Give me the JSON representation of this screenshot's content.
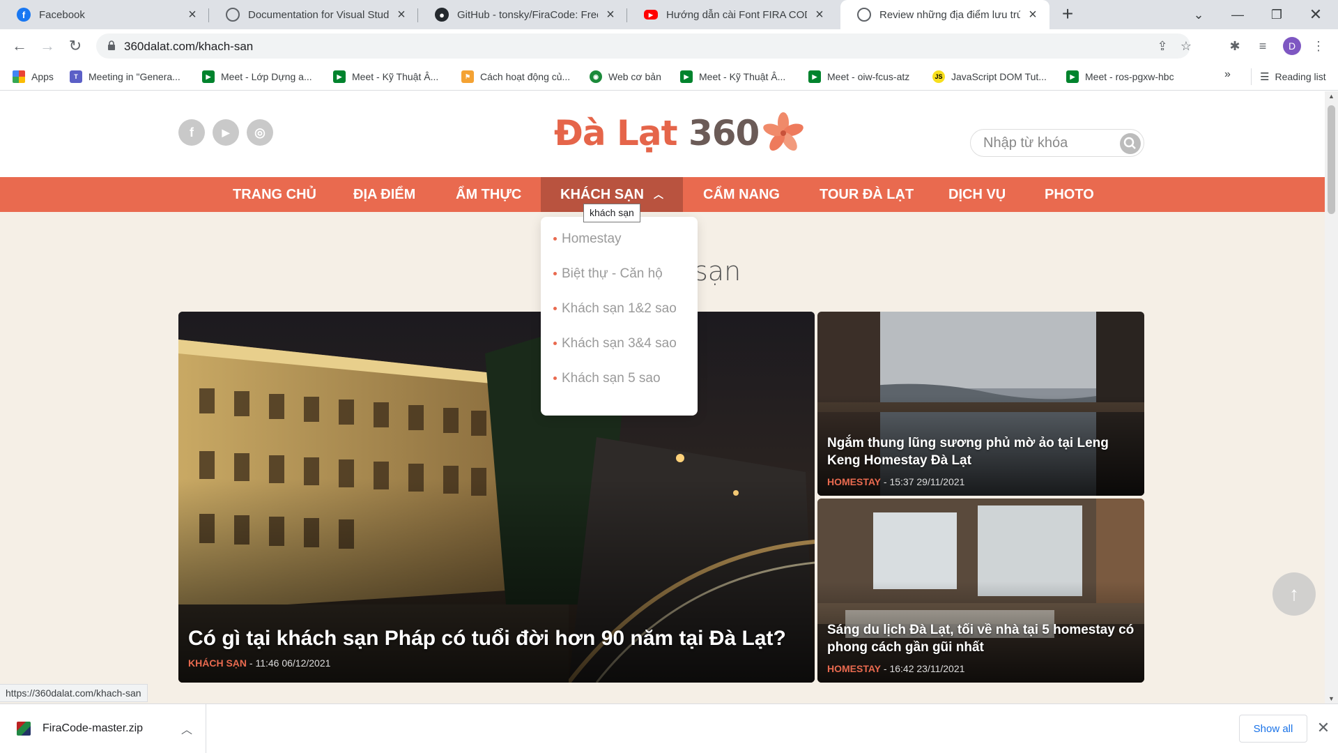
{
  "browser": {
    "tabs": [
      {
        "title": "Facebook",
        "icon": "facebook-icon",
        "color": "#1877f2"
      },
      {
        "title": "Documentation for Visual Studio",
        "icon": "globe-icon",
        "color": "#5f6368"
      },
      {
        "title": "GitHub - tonsky/FiraCode: Free m",
        "icon": "github-icon",
        "color": "#24292e"
      },
      {
        "title": "Hướng dẫn cài Font FIRA CODE c",
        "icon": "youtube-icon",
        "color": "#ff0000"
      },
      {
        "title": "Review những địa điểm lưu trú h",
        "icon": "globe-icon",
        "color": "#5f6368",
        "active": true
      }
    ],
    "new_tab": "+",
    "url": "360dalat.com/khach-san",
    "profile_initial": "D",
    "bookmarks": [
      {
        "label": "Apps",
        "icon": "apps-grid-icon"
      },
      {
        "label": "Meeting in \"Genera...",
        "icon": "teams-icon"
      },
      {
        "label": "Meet - Lớp Dựng a...",
        "icon": "google-meet-icon"
      },
      {
        "label": "Meet - Kỹ Thuật Â...",
        "icon": "google-meet-icon"
      },
      {
        "label": "Cách hoạt động củ...",
        "icon": "bookmark-flag-icon"
      },
      {
        "label": "Web cơ bản",
        "icon": "web-globe-icon"
      },
      {
        "label": "Meet - Kỹ Thuật Â...",
        "icon": "google-meet-icon"
      },
      {
        "label": "Meet - oiw-fcus-atz",
        "icon": "google-meet-icon"
      },
      {
        "label": "JavaScript DOM Tut...",
        "icon": "js-icon"
      },
      {
        "label": "Meet - ros-pgxw-hbc",
        "icon": "google-meet-icon"
      }
    ],
    "bookmarks_overflow": "»",
    "reading_list": "Reading list",
    "status_url": "https://360dalat.com/khach-san",
    "download": {
      "filename": "FiraCode-master.zip",
      "show_all": "Show all"
    }
  },
  "site": {
    "logo": {
      "text": "Đà Lạt ",
      "num": "360"
    },
    "social": [
      {
        "icon": "facebook-icon",
        "glyph": "f"
      },
      {
        "icon": "youtube-icon",
        "glyph": "▶"
      },
      {
        "icon": "instagram-icon",
        "glyph": "◎"
      }
    ],
    "search_placeholder": "Nhập từ khóa",
    "nav": [
      "TRANG CHỦ",
      "ĐỊA ĐIỂM",
      "ẨM THỰC",
      "KHÁCH SẠN",
      "CẨM NANG",
      "TOUR ĐÀ LẠT",
      "DỊCH VỤ",
      "PHOTO"
    ],
    "active_nav": "KHÁCH SẠN",
    "tooltip": "khách sạn",
    "dropdown": [
      "Homestay",
      "Biệt thự - Căn hộ",
      "Khách sạn 1&2 sao",
      "Khách sạn 3&4 sao",
      "Khách sạn 5 sao"
    ],
    "section_title_visible": "sạn",
    "cards": [
      {
        "title": "Có gì tại khách sạn Pháp có tuổi đời hơn 90 năm tại Đà Lạt?",
        "category": "KHÁCH SẠN",
        "time": " - 11:46 06/12/2021"
      },
      {
        "title": "Ngắm thung lũng sương phủ mờ ảo tại Leng Keng Homestay Đà Lạt",
        "category": "HOMESTAY",
        "time": " - 15:37 29/11/2021"
      },
      {
        "title": "Sáng du lịch Đà Lạt, tối về nhà tại 5 homestay có phong cách gần gũi nhất",
        "category": "HOMESTAY",
        "time": " - 16:42 23/11/2021"
      }
    ],
    "back_to_top": "↑"
  },
  "colors": {
    "brand": "#e96a4f",
    "nav_active": "#b9533f",
    "page_bg": "#f5efe6"
  }
}
